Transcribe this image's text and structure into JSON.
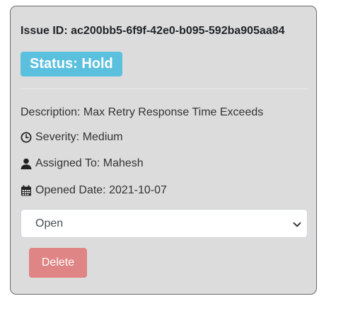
{
  "issue": {
    "id_text": "Issue ID: ac200bb5-6f9f-42e0-b095-592ba905aa84",
    "status_text": "Status: Hold",
    "description_text": "Description: Max Retry Response Time Exceeds",
    "severity_text": "Severity: Medium",
    "assigned_text": "Assigned To: Mahesh",
    "opened_text": "Opened Date: 2021-10-07"
  },
  "status_select": {
    "selected": "Open"
  },
  "actions": {
    "delete_label": "Delete"
  },
  "icons": {
    "severity": "clock-icon",
    "assigned": "user-icon",
    "opened": "calendar-icon",
    "select": "chevron-down-icon"
  },
  "colors": {
    "card_bg": "#dcdcdc",
    "status_badge": "#5bc0de",
    "delete_button": "#e08585"
  }
}
